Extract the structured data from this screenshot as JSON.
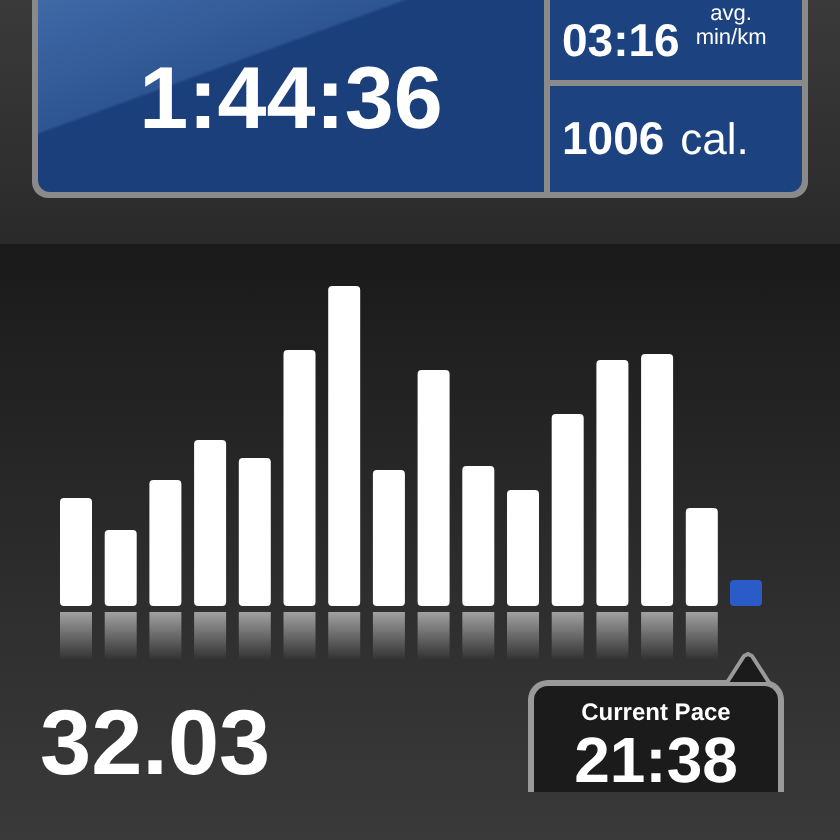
{
  "summary": {
    "duration": "1:44:36",
    "pace": {
      "value": "03:16",
      "label_top": "avg.",
      "label_bottom": "min/km"
    },
    "calories": {
      "value": "1006",
      "unit": "cal."
    }
  },
  "distance": "32.03",
  "current_pace": {
    "label": "Current Pace",
    "value": "21:38"
  }
}
